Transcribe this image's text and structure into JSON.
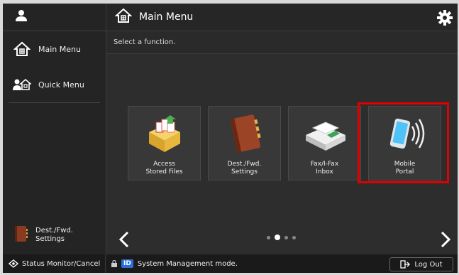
{
  "sidebar": {
    "items": [
      {
        "label": "Main Menu",
        "icon": "home-icon"
      },
      {
        "label": "Quick Menu",
        "icon": "quick-menu-icon"
      }
    ],
    "bottom_item": {
      "label_line1": "Dest./Fwd.",
      "label_line2": "Settings"
    }
  },
  "header": {
    "title": "Main Menu"
  },
  "subtitle": "Select a function.",
  "tiles": [
    {
      "line1": "Access",
      "line2": "Stored Files"
    },
    {
      "line1": "Dest./Fwd.",
      "line2": "Settings"
    },
    {
      "line1": "Fax/I-Fax",
      "line2": "Inbox"
    },
    {
      "line1": "Mobile",
      "line2": "Portal"
    }
  ],
  "pagination": {
    "current_page": 2,
    "total_pages": 4
  },
  "status_bar": {
    "left_label": "Status Monitor/Cancel",
    "id_badge": "ID",
    "message": "System Management mode.",
    "logout_label": "Log Out"
  },
  "colors": {
    "highlight": "#e00000",
    "id_badge": "#2b6fd8"
  }
}
